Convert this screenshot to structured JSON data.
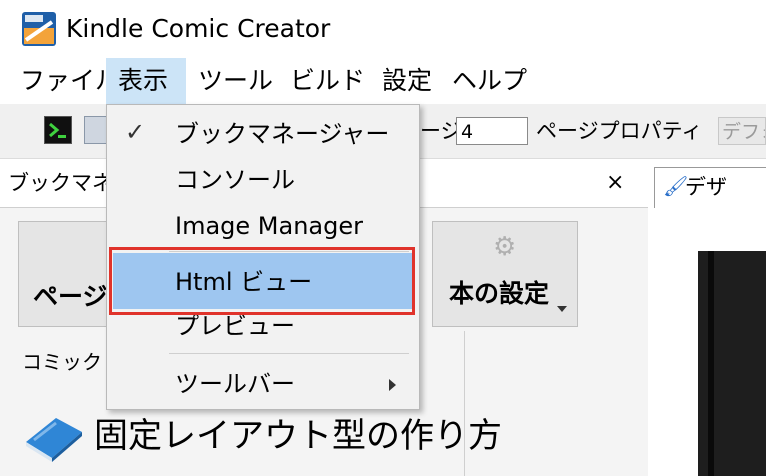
{
  "window": {
    "title": "Kindle Comic Creator",
    "app_icon": "kindle-app-icon"
  },
  "menubar": {
    "items": [
      {
        "label": "ファイル",
        "active": false
      },
      {
        "label": "表示",
        "active": true
      },
      {
        "label": "ツール",
        "active": false
      },
      {
        "label": "ビルド",
        "active": false
      },
      {
        "label": "設定",
        "active": false
      },
      {
        "label": "ヘルプ",
        "active": false
      }
    ]
  },
  "toolbar": {
    "page_label": "ージ",
    "page_value": "4",
    "page_props_label": "ページプロパティ",
    "page_props_value": "デフォ"
  },
  "book_panel": {
    "title": "ブックマネ",
    "close_label": "×",
    "pages_button": "ページ",
    "book_settings_button": "本の設定",
    "comic_label": "コミック"
  },
  "design_area": {
    "tab_label": "デザ"
  },
  "view_menu": {
    "items": [
      {
        "label": "ブックマネージャー",
        "checked": true
      },
      {
        "label": "コンソール"
      },
      {
        "label": "Image Manager"
      },
      {
        "label": "Html ビュー",
        "highlighted": true,
        "outlined": true
      },
      {
        "label": "プレビュー"
      },
      {
        "label": "ツールバー",
        "has_submenu": true
      }
    ],
    "check_mark": "✓"
  },
  "caption": "固定レイアウト型の作り方",
  "colors": {
    "menu_active": "#cce4f7",
    "highlight": "#9ec6f0",
    "outline": "#e0332b",
    "toolbar_bg": "#f0f0f0"
  }
}
